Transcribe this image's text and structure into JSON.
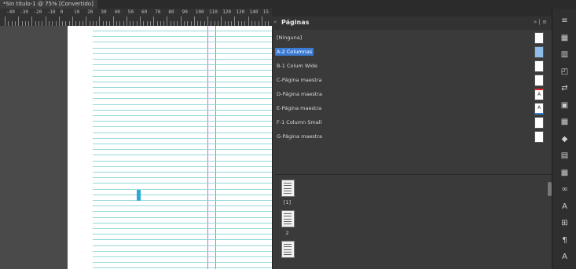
{
  "document_tab": {
    "title": "*Sin título-1 @ 75% [Convertido]",
    "close": "×"
  },
  "ruler": {
    "labels": [
      "-40",
      "-30",
      "-20",
      "-10",
      "0",
      "10",
      "20",
      "30",
      "40",
      "50",
      "60",
      "70",
      "80",
      "90",
      "100",
      "110",
      "120",
      "130",
      "140",
      "15"
    ]
  },
  "panel": {
    "title": "Páginas",
    "collapse": "«",
    "menu": "» | ≡"
  },
  "masters": [
    {
      "label": "[Ninguna]",
      "selected": false
    },
    {
      "label": "A-2 Columnas",
      "selected": true
    },
    {
      "label": "B-1 Colum Wide",
      "selected": false
    },
    {
      "label": "C-Página maestra",
      "selected": false
    },
    {
      "label": "D-Página maestra",
      "selected": false
    },
    {
      "label": "E-Página maestra",
      "selected": false
    },
    {
      "label": "F-1 Column Small",
      "selected": false
    },
    {
      "label": "G-Página maestra",
      "selected": false
    }
  ],
  "master_thumb_marks": {
    "d": "A",
    "e": "A"
  },
  "pages": [
    {
      "num": "[1]"
    },
    {
      "num": "2"
    },
    {
      "num": ""
    }
  ],
  "tools": [
    "≡-icon",
    "grid-icon",
    "doc-icon",
    "window-icon",
    "text-wrap-icon",
    "align-icon",
    "frame-icon",
    "swatch-icon",
    "stroke-icon",
    "layers-icon",
    "link-icon",
    "char-icon",
    "paragraph-icon",
    "table-icon",
    "A"
  ],
  "tool_glyphs": [
    "≡",
    "▦",
    "▥",
    "◰",
    "⇄",
    "▣",
    "▦",
    "◆",
    "▤",
    "▦",
    "∞",
    "A",
    "⊞",
    "¶",
    "A"
  ]
}
